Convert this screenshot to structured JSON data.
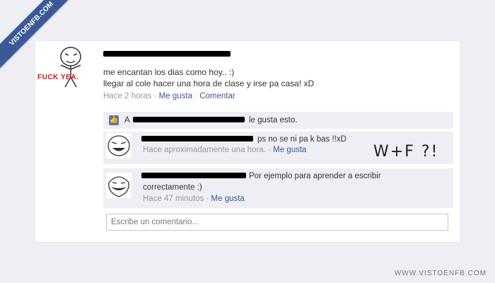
{
  "watermark": {
    "corner": "VISTOENFB.COM",
    "footer": "WWW.VISTOENFB.COM"
  },
  "post": {
    "meme_caption": "FUCK YEA.",
    "text_line1": "me encantan los dias como hoy.. :)",
    "text_line2": "llegar al cole hacer una hora de clase y irse pa casa! xD",
    "time": "Hace 2 horas",
    "like_link": "Me gusta",
    "comment_link": "Comentar",
    "separator": "·"
  },
  "likes": {
    "prefix": "A",
    "suffix": "le gusta esto."
  },
  "comments": [
    {
      "text": "ps no se ni pa k bas !!xD",
      "time": "Hace aproximadamente una hora.",
      "like": "Me gusta",
      "annotation": "W+F ?!"
    },
    {
      "text": "Por ejemplo para aprender a escribir",
      "text2": "correctamente :)",
      "time": "Hace 47 minutos",
      "like": "Me gusta"
    }
  ],
  "input": {
    "placeholder": "Escribe un comentario..."
  },
  "colors": {
    "link": "#3b5998",
    "bg": "#edeff4",
    "meta": "#999999",
    "meme_red": "#d31717"
  }
}
